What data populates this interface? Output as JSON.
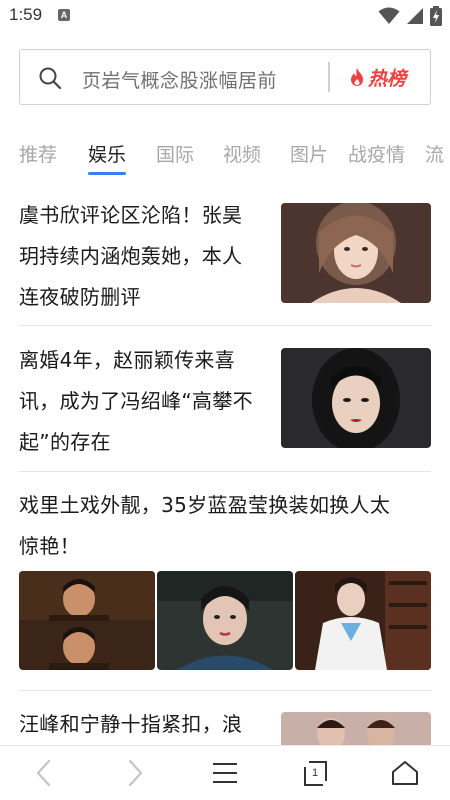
{
  "status_bar": {
    "time": "1:59",
    "notification_letter": "A",
    "icons": [
      "wifi-icon",
      "signal-icon",
      "battery-charging-icon"
    ]
  },
  "search": {
    "placeholder": "页岩气概念股涨幅居前",
    "hot_rank_label": "热榜",
    "icon": "search-icon"
  },
  "tabs": [
    {
      "label": "推荐",
      "active": false
    },
    {
      "label": "娱乐",
      "active": true
    },
    {
      "label": "国际",
      "active": false
    },
    {
      "label": "视频",
      "active": false
    },
    {
      "label": "图片",
      "active": false
    },
    {
      "label": "战疫情",
      "active": false
    },
    {
      "label": "流",
      "active": false
    }
  ],
  "articles": [
    {
      "title_lines": [
        "虞书欣评论区沦陷！张昊",
        "玥持续内涵炮轰她，本人",
        "连夜破防删评"
      ]
    },
    {
      "title_lines": [
        "离婚4年，赵丽颖传来喜",
        "讯，成为了冯绍峰“高攀不",
        "起”的存在"
      ]
    },
    {
      "title_lines": [
        "戏里土戏外靓，35岁蓝盈莹换装如换人太",
        "惊艳！"
      ]
    },
    {
      "title_lines": [
        "汪峰和宁静十指紧扣，浪"
      ]
    }
  ],
  "toolbar": {
    "tab_count": "1",
    "icons": [
      "back-icon",
      "forward-icon",
      "menu-icon",
      "tabs-icon",
      "home-icon"
    ]
  },
  "colors": {
    "accent_blue": "#3d7df2",
    "hot_red": "#f04142",
    "inactive_tab": "#a8a8a8"
  }
}
